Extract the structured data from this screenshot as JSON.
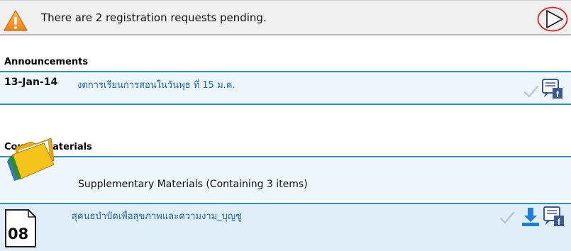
{
  "notification": {
    "message": "There are 2 registration requests pending.",
    "icons": {
      "warning": "warning-triangle-icon",
      "next": "play-arrow-icon"
    },
    "highlight_color": "#e0201b"
  },
  "announcements": {
    "title": "Announcements",
    "items": [
      {
        "date": "13-Jan-14",
        "title": "งดการเรียนการสอนในวันพุธ ที่ 15 ม.ค."
      }
    ]
  },
  "materials": {
    "title": "Course Materials",
    "folder": {
      "label": "Supplementary Materials (Containing 3 items)",
      "icon": "folder-icon"
    },
    "files": [
      {
        "badge": "08",
        "title": "สุคนธบำบัดเพื่อสุขภาพและความงาม_บุญชู"
      }
    ]
  },
  "colors": {
    "accent": "#2e8fd1",
    "link": "#1c63b4",
    "row_bg": "#edf6fd",
    "facebook": "#3b5998"
  }
}
